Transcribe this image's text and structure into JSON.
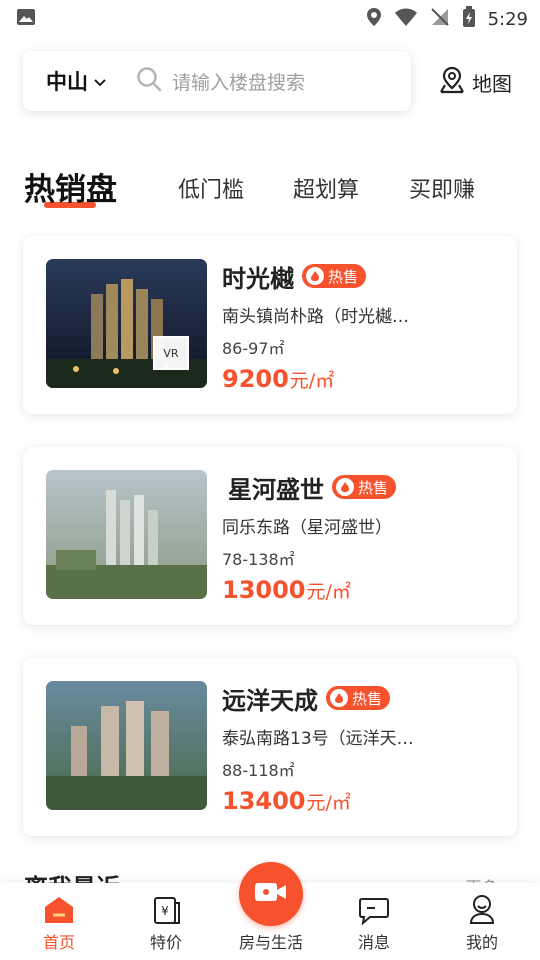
{
  "status_bar": {
    "time": "5:29"
  },
  "search": {
    "city": "中山",
    "placeholder": "请输入楼盘搜索",
    "map_label": "地图"
  },
  "tabs": [
    {
      "label": "热销盘",
      "active": true
    },
    {
      "label": "低门槛"
    },
    {
      "label": "超划算"
    },
    {
      "label": "买即赚"
    }
  ],
  "listings": [
    {
      "name": "时光樾",
      "badge": "热售",
      "address": "南头镇尚朴路（时光樾…",
      "area": "86-97㎡",
      "price": "9200",
      "unit": "元/㎡",
      "vr_label": "VR"
    },
    {
      "name": "星河盛世",
      "badge": "热售",
      "address": "同乐东路（星河盛世）",
      "area": "78-138㎡",
      "price": "13000",
      "unit": "元/㎡"
    },
    {
      "name": "远洋天成",
      "badge": "热售",
      "address": "泰弘南路13号（远洋天…",
      "area": "88-118㎡",
      "price": "13400",
      "unit": "元/㎡"
    }
  ],
  "section_peek": {
    "title": "离我最近",
    "more": "更多 >"
  },
  "bottom_nav": [
    {
      "label": "首页",
      "icon": "home-icon",
      "active": true
    },
    {
      "label": "特价",
      "icon": "price-tag-icon"
    },
    {
      "label": "房与生活",
      "icon": "video-camera-icon"
    },
    {
      "label": "消息",
      "icon": "message-icon"
    },
    {
      "label": "我的",
      "icon": "profile-icon"
    }
  ],
  "colors": {
    "accent": "#f5522d",
    "text": "#222222",
    "placeholder": "#a0a0a0"
  }
}
